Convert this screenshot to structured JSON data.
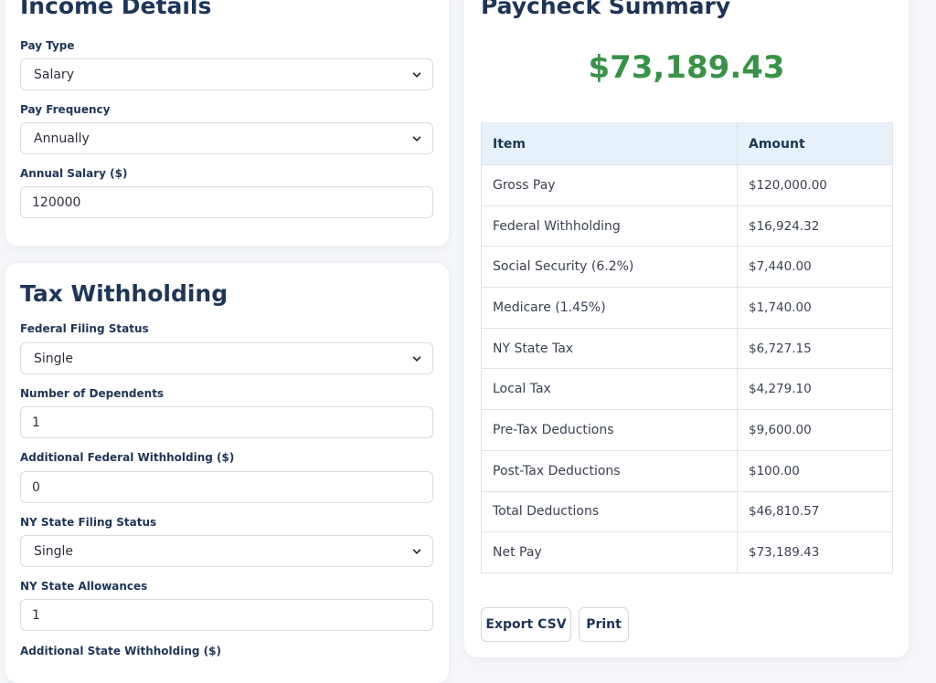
{
  "income": {
    "title": "Income Details",
    "pay_type_label": "Pay Type",
    "pay_type_value": "Salary",
    "pay_frequency_label": "Pay Frequency",
    "pay_frequency_value": "Annually",
    "annual_salary_label": "Annual Salary ($)",
    "annual_salary_value": "120000"
  },
  "tax": {
    "title": "Tax Withholding",
    "federal_filing_label": "Federal Filing Status",
    "federal_filing_value": "Single",
    "dependents_label": "Number of Dependents",
    "dependents_value": "1",
    "additional_federal_label": "Additional Federal Withholding ($)",
    "additional_federal_value": "0",
    "ny_filing_label": "NY State Filing Status",
    "ny_filing_value": "Single",
    "ny_allowances_label": "NY State Allowances",
    "ny_allowances_value": "1",
    "additional_state_label": "Additional State Withholding ($)"
  },
  "summary": {
    "title": "Paycheck Summary",
    "net_amount": "$73,189.43",
    "headers": {
      "item": "Item",
      "amount": "Amount"
    },
    "rows": [
      {
        "item": "Gross Pay",
        "amount": "$120,000.00"
      },
      {
        "item": "Federal Withholding",
        "amount": "$16,924.32"
      },
      {
        "item": "Social Security (6.2%)",
        "amount": "$7,440.00"
      },
      {
        "item": "Medicare (1.45%)",
        "amount": "$1,740.00"
      },
      {
        "item": "NY State Tax",
        "amount": "$6,727.15"
      },
      {
        "item": "Local Tax",
        "amount": "$4,279.10"
      },
      {
        "item": "Pre-Tax Deductions",
        "amount": "$9,600.00"
      },
      {
        "item": "Post-Tax Deductions",
        "amount": "$100.00"
      },
      {
        "item": "Total Deductions",
        "amount": "$46,810.57"
      },
      {
        "item": "Net Pay",
        "amount": "$73,189.43"
      }
    ],
    "export_label": "Export CSV",
    "print_label": "Print"
  },
  "colors": {
    "heading": "#1e3557",
    "net_amount": "#3a9248",
    "table_header_bg": "#e6f1fb"
  },
  "icons": {
    "select_chevron": "chevron-down-icon"
  }
}
